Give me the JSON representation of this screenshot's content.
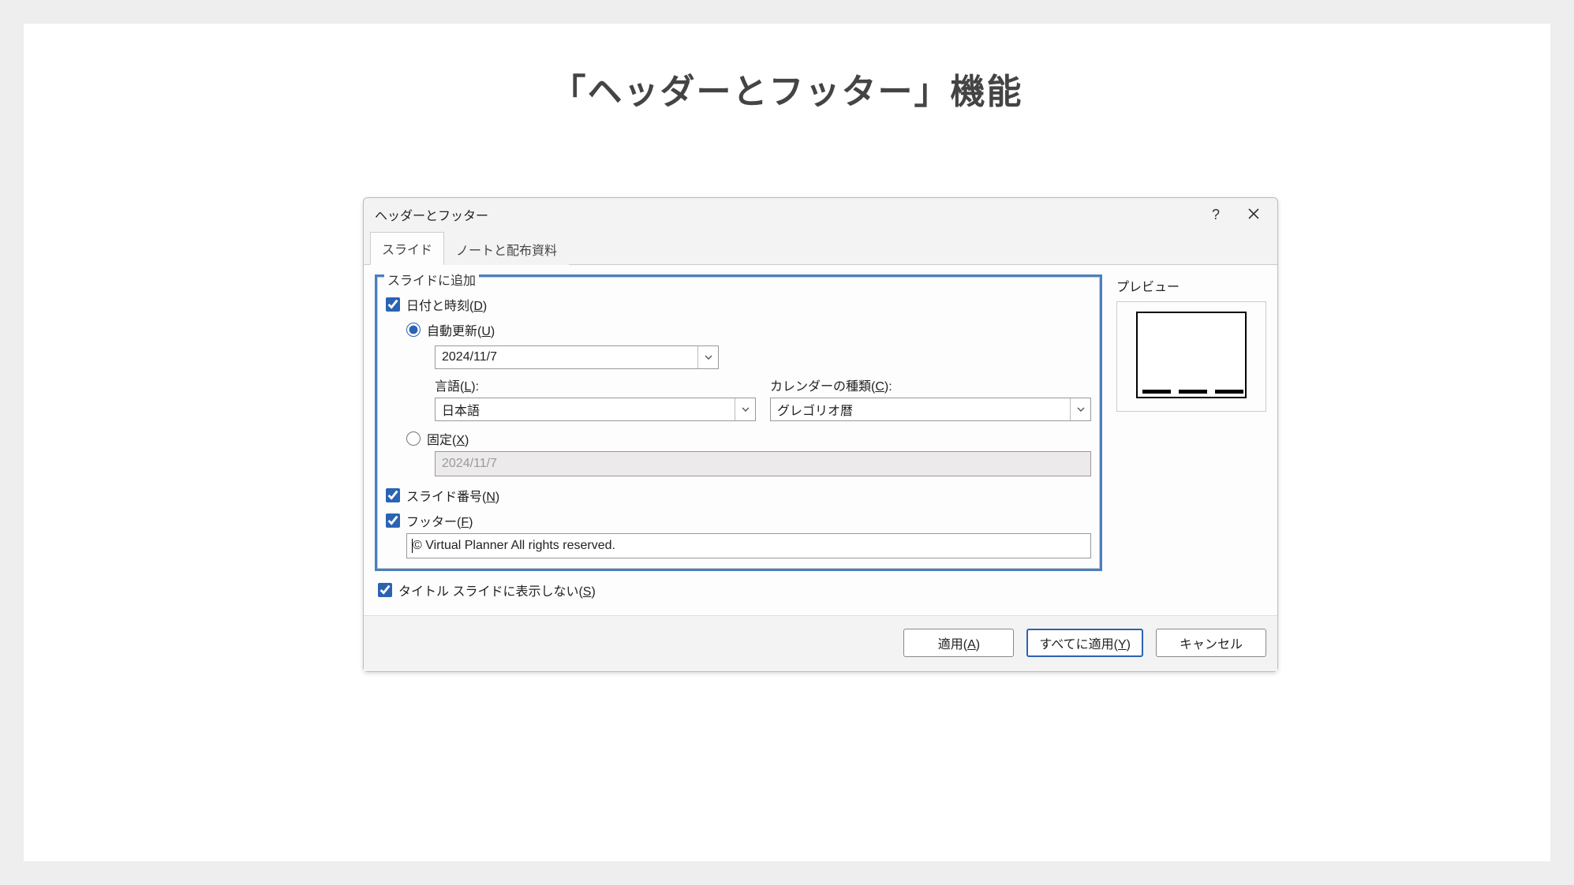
{
  "page": {
    "title": "「ヘッダーとフッター」機能"
  },
  "dialog": {
    "title": "ヘッダーとフッター",
    "help_label": "?",
    "tabs": {
      "slide": "スライド",
      "notes": "ノートと配布資料"
    },
    "group_label": "スライドに追加",
    "date_time": {
      "label_pre": "日付と時刻(",
      "label_key": "D",
      "label_post": ")",
      "auto_pre": "自動更新(",
      "auto_key": "U",
      "auto_post": ")",
      "auto_value": "2024/11/7",
      "lang_label_pre": "言語(",
      "lang_label_key": "L",
      "lang_label_post": "):",
      "lang_value": "日本語",
      "cal_label_pre": "カレンダーの種類(",
      "cal_label_key": "C",
      "cal_label_post": "):",
      "cal_value": "グレゴリオ暦",
      "fixed_pre": "固定(",
      "fixed_key": "X",
      "fixed_post": ")",
      "fixed_value": "2024/11/7"
    },
    "slide_number": {
      "label_pre": "スライド番号(",
      "label_key": "N",
      "label_post": ")"
    },
    "footer": {
      "label_pre": "フッター(",
      "label_key": "F",
      "label_post": ")",
      "value": "© Virtual Planner All rights reserved."
    },
    "hide_title": {
      "label_pre": "タイトル スライドに表示しない(",
      "label_key": "S",
      "label_post": ")"
    },
    "preview_label": "プレビュー",
    "buttons": {
      "apply_pre": "適用(",
      "apply_key": "A",
      "apply_post": ")",
      "apply_all_pre": "すべてに適用(",
      "apply_all_key": "Y",
      "apply_all_post": ")",
      "cancel": "キャンセル"
    }
  }
}
